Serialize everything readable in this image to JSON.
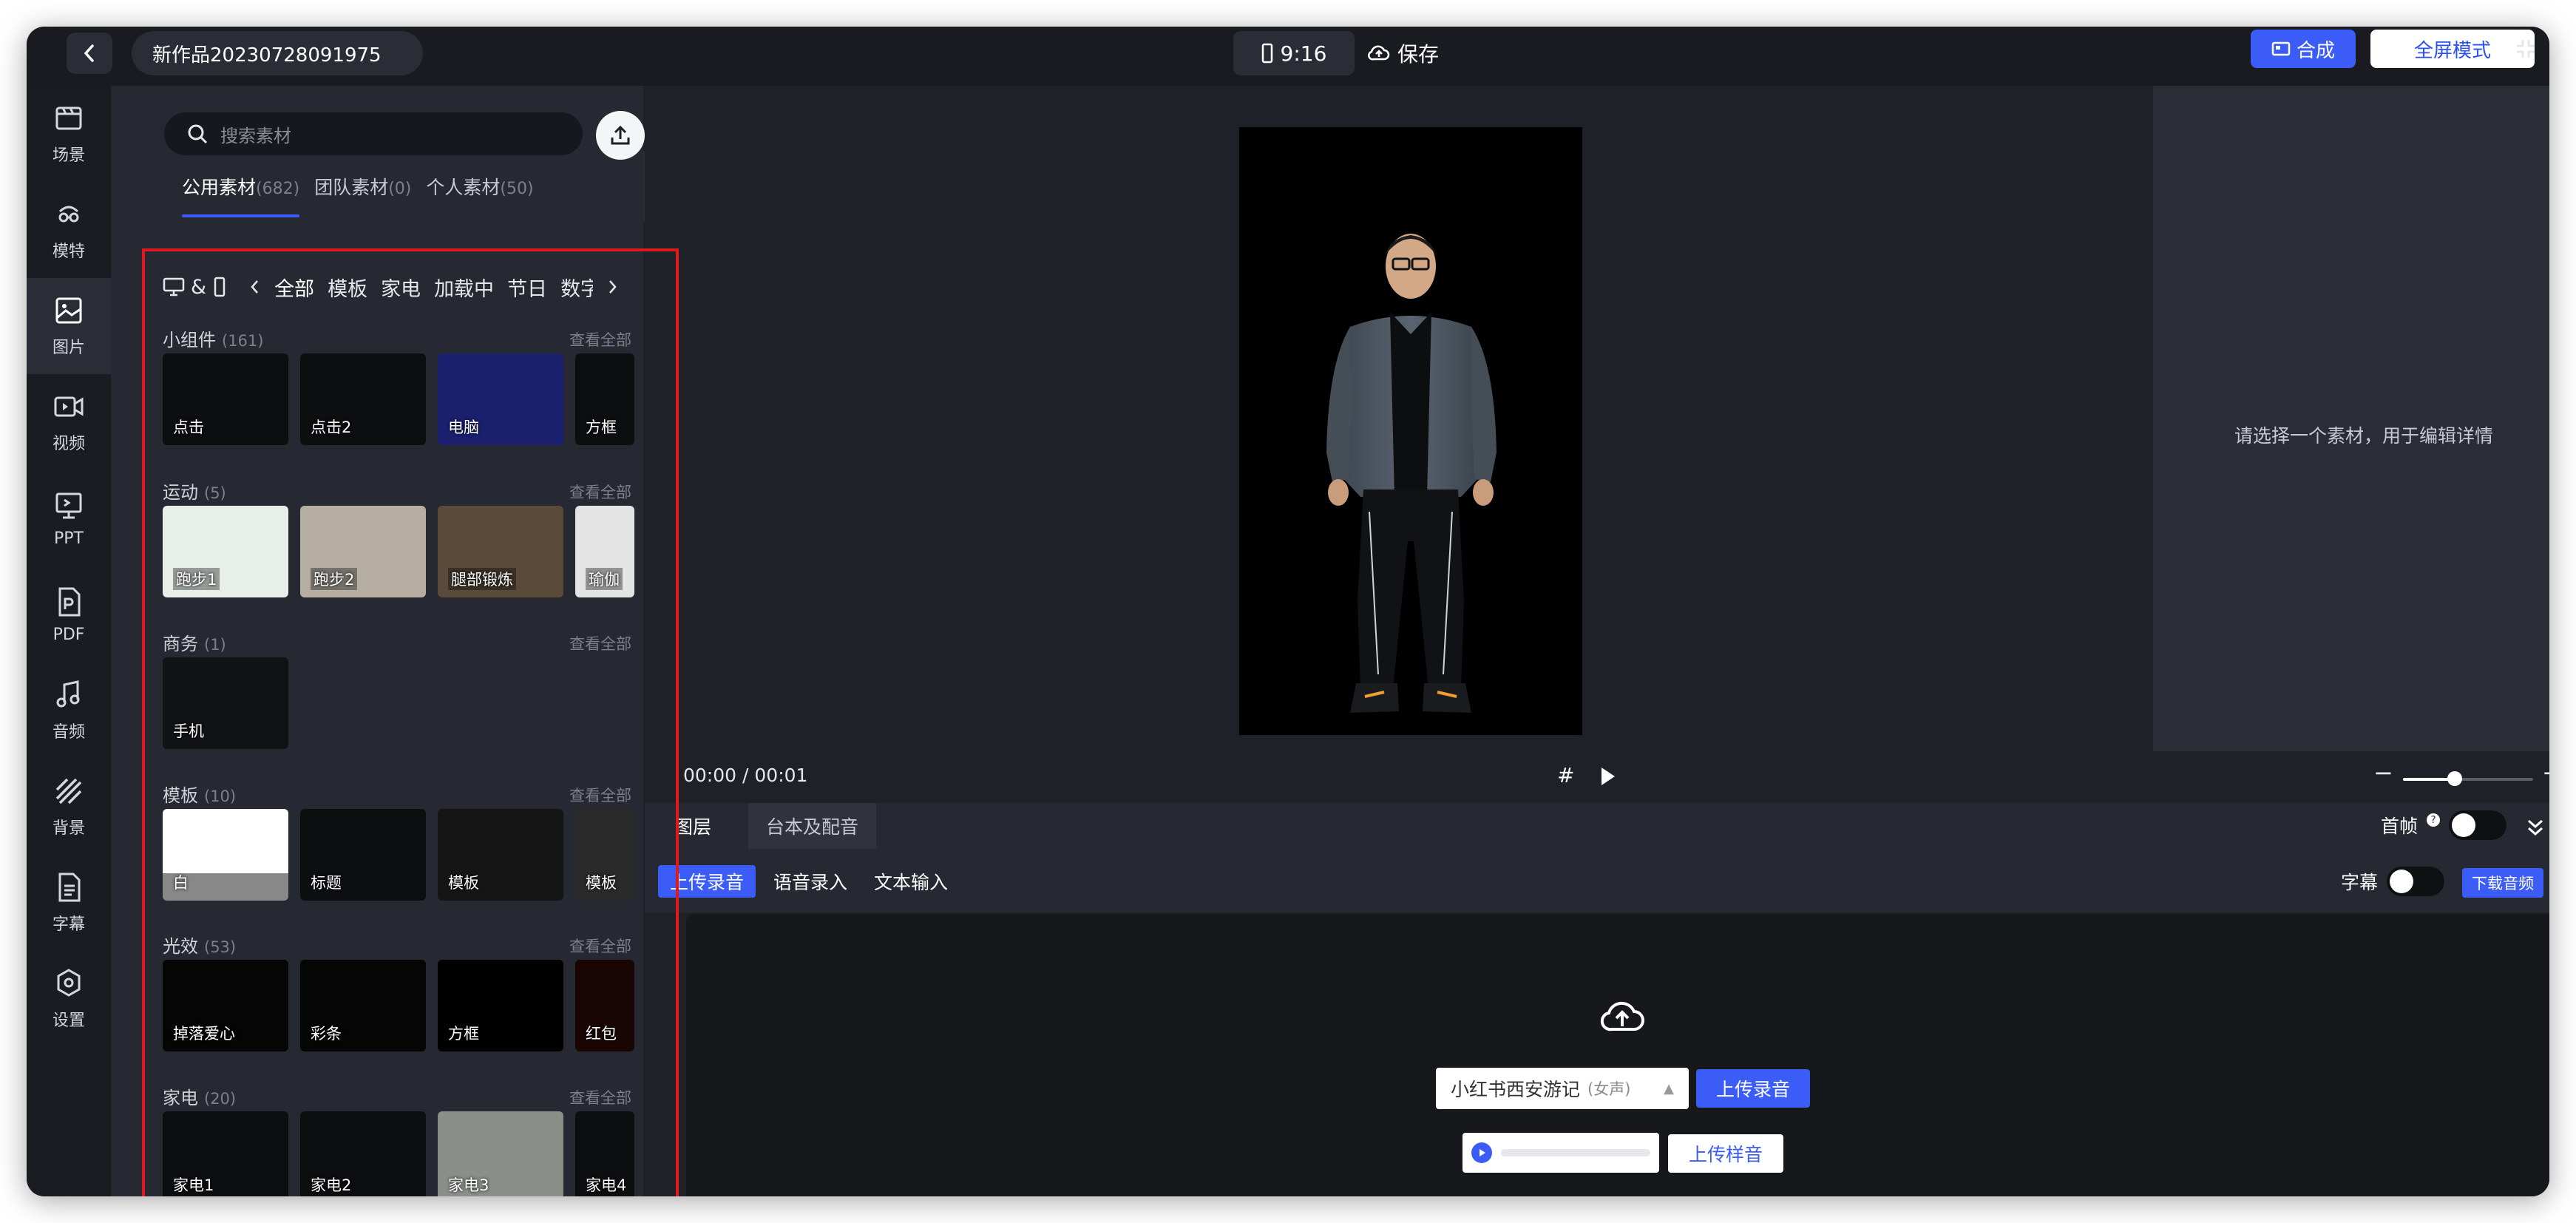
{
  "topbar": {
    "project_title": "新作品20230728091975",
    "ratio": "9:16",
    "save_label": "保存",
    "compose_label": "合成",
    "fullscreen_label": "全屏模式"
  },
  "nav": {
    "items": [
      {
        "label": "场景",
        "icon": "scene-icon"
      },
      {
        "label": "模特",
        "icon": "model-icon"
      },
      {
        "label": "图片",
        "icon": "image-icon"
      },
      {
        "label": "视频",
        "icon": "video-icon"
      },
      {
        "label": "PPT",
        "icon": "ppt-icon"
      },
      {
        "label": "PDF",
        "icon": "pdf-icon"
      },
      {
        "label": "音频",
        "icon": "music-icon"
      },
      {
        "label": "背景",
        "icon": "background-icon"
      },
      {
        "label": "字幕",
        "icon": "subtitle-icon"
      },
      {
        "label": "设置",
        "icon": "settings-icon"
      }
    ],
    "active": "图片"
  },
  "panel": {
    "search_placeholder": "搜索素材",
    "lib_tabs": [
      {
        "label": "公用素材",
        "count": "(682)"
      },
      {
        "label": "团队素材",
        "count": "(0)"
      },
      {
        "label": "个人素材",
        "count": "(50)"
      }
    ],
    "device_label": "&",
    "categories": [
      "全部",
      "模板",
      "家电",
      "加载中",
      "节日",
      "数字"
    ],
    "sections": [
      {
        "title": "小组件",
        "count": "(161)",
        "view_all": "查看全部",
        "items": [
          "点击",
          "点击2",
          "电脑",
          "方框"
        ]
      },
      {
        "title": "运动",
        "count": "(5)",
        "view_all": "查看全部",
        "items": [
          "跑步1",
          "跑步2",
          "腿部锻炼",
          "瑜伽"
        ]
      },
      {
        "title": "商务",
        "count": "(1)",
        "view_all": "查看全部",
        "items": [
          "手机"
        ]
      },
      {
        "title": "模板",
        "count": "(10)",
        "view_all": "查看全部",
        "items": [
          "白",
          "标题",
          "模板",
          "模板"
        ]
      },
      {
        "title": "光效",
        "count": "(53)",
        "view_all": "查看全部",
        "items": [
          "掉落爱心",
          "彩条",
          "方框",
          "红包"
        ]
      },
      {
        "title": "家电",
        "count": "(20)",
        "view_all": "查看全部",
        "items": [
          "家电1",
          "家电2",
          "家电3",
          "家电4"
        ]
      }
    ]
  },
  "inspector": {
    "message": "请选择一个素材，用于编辑详情"
  },
  "timeline": {
    "current": "00:00",
    "total": "00:01",
    "separator": "/",
    "hash": "#",
    "zoom_level": 0.4
  },
  "tabs": {
    "items": [
      "图层",
      "台本及配音"
    ],
    "first_frame_label": "首帧"
  },
  "audio": {
    "sub_tabs": [
      "上传录音",
      "语音录入",
      "文本输入"
    ],
    "subtitle_label": "字幕",
    "download_label": "下载音频",
    "voice_name": "小红书西安游记",
    "voice_type": "(女声)",
    "upload_recording": "上传录音",
    "upload_sample": "上传样音"
  },
  "colors": {
    "accent": "#3b5cf6",
    "highlight": "#e0191f",
    "bg": "#1f2128"
  }
}
